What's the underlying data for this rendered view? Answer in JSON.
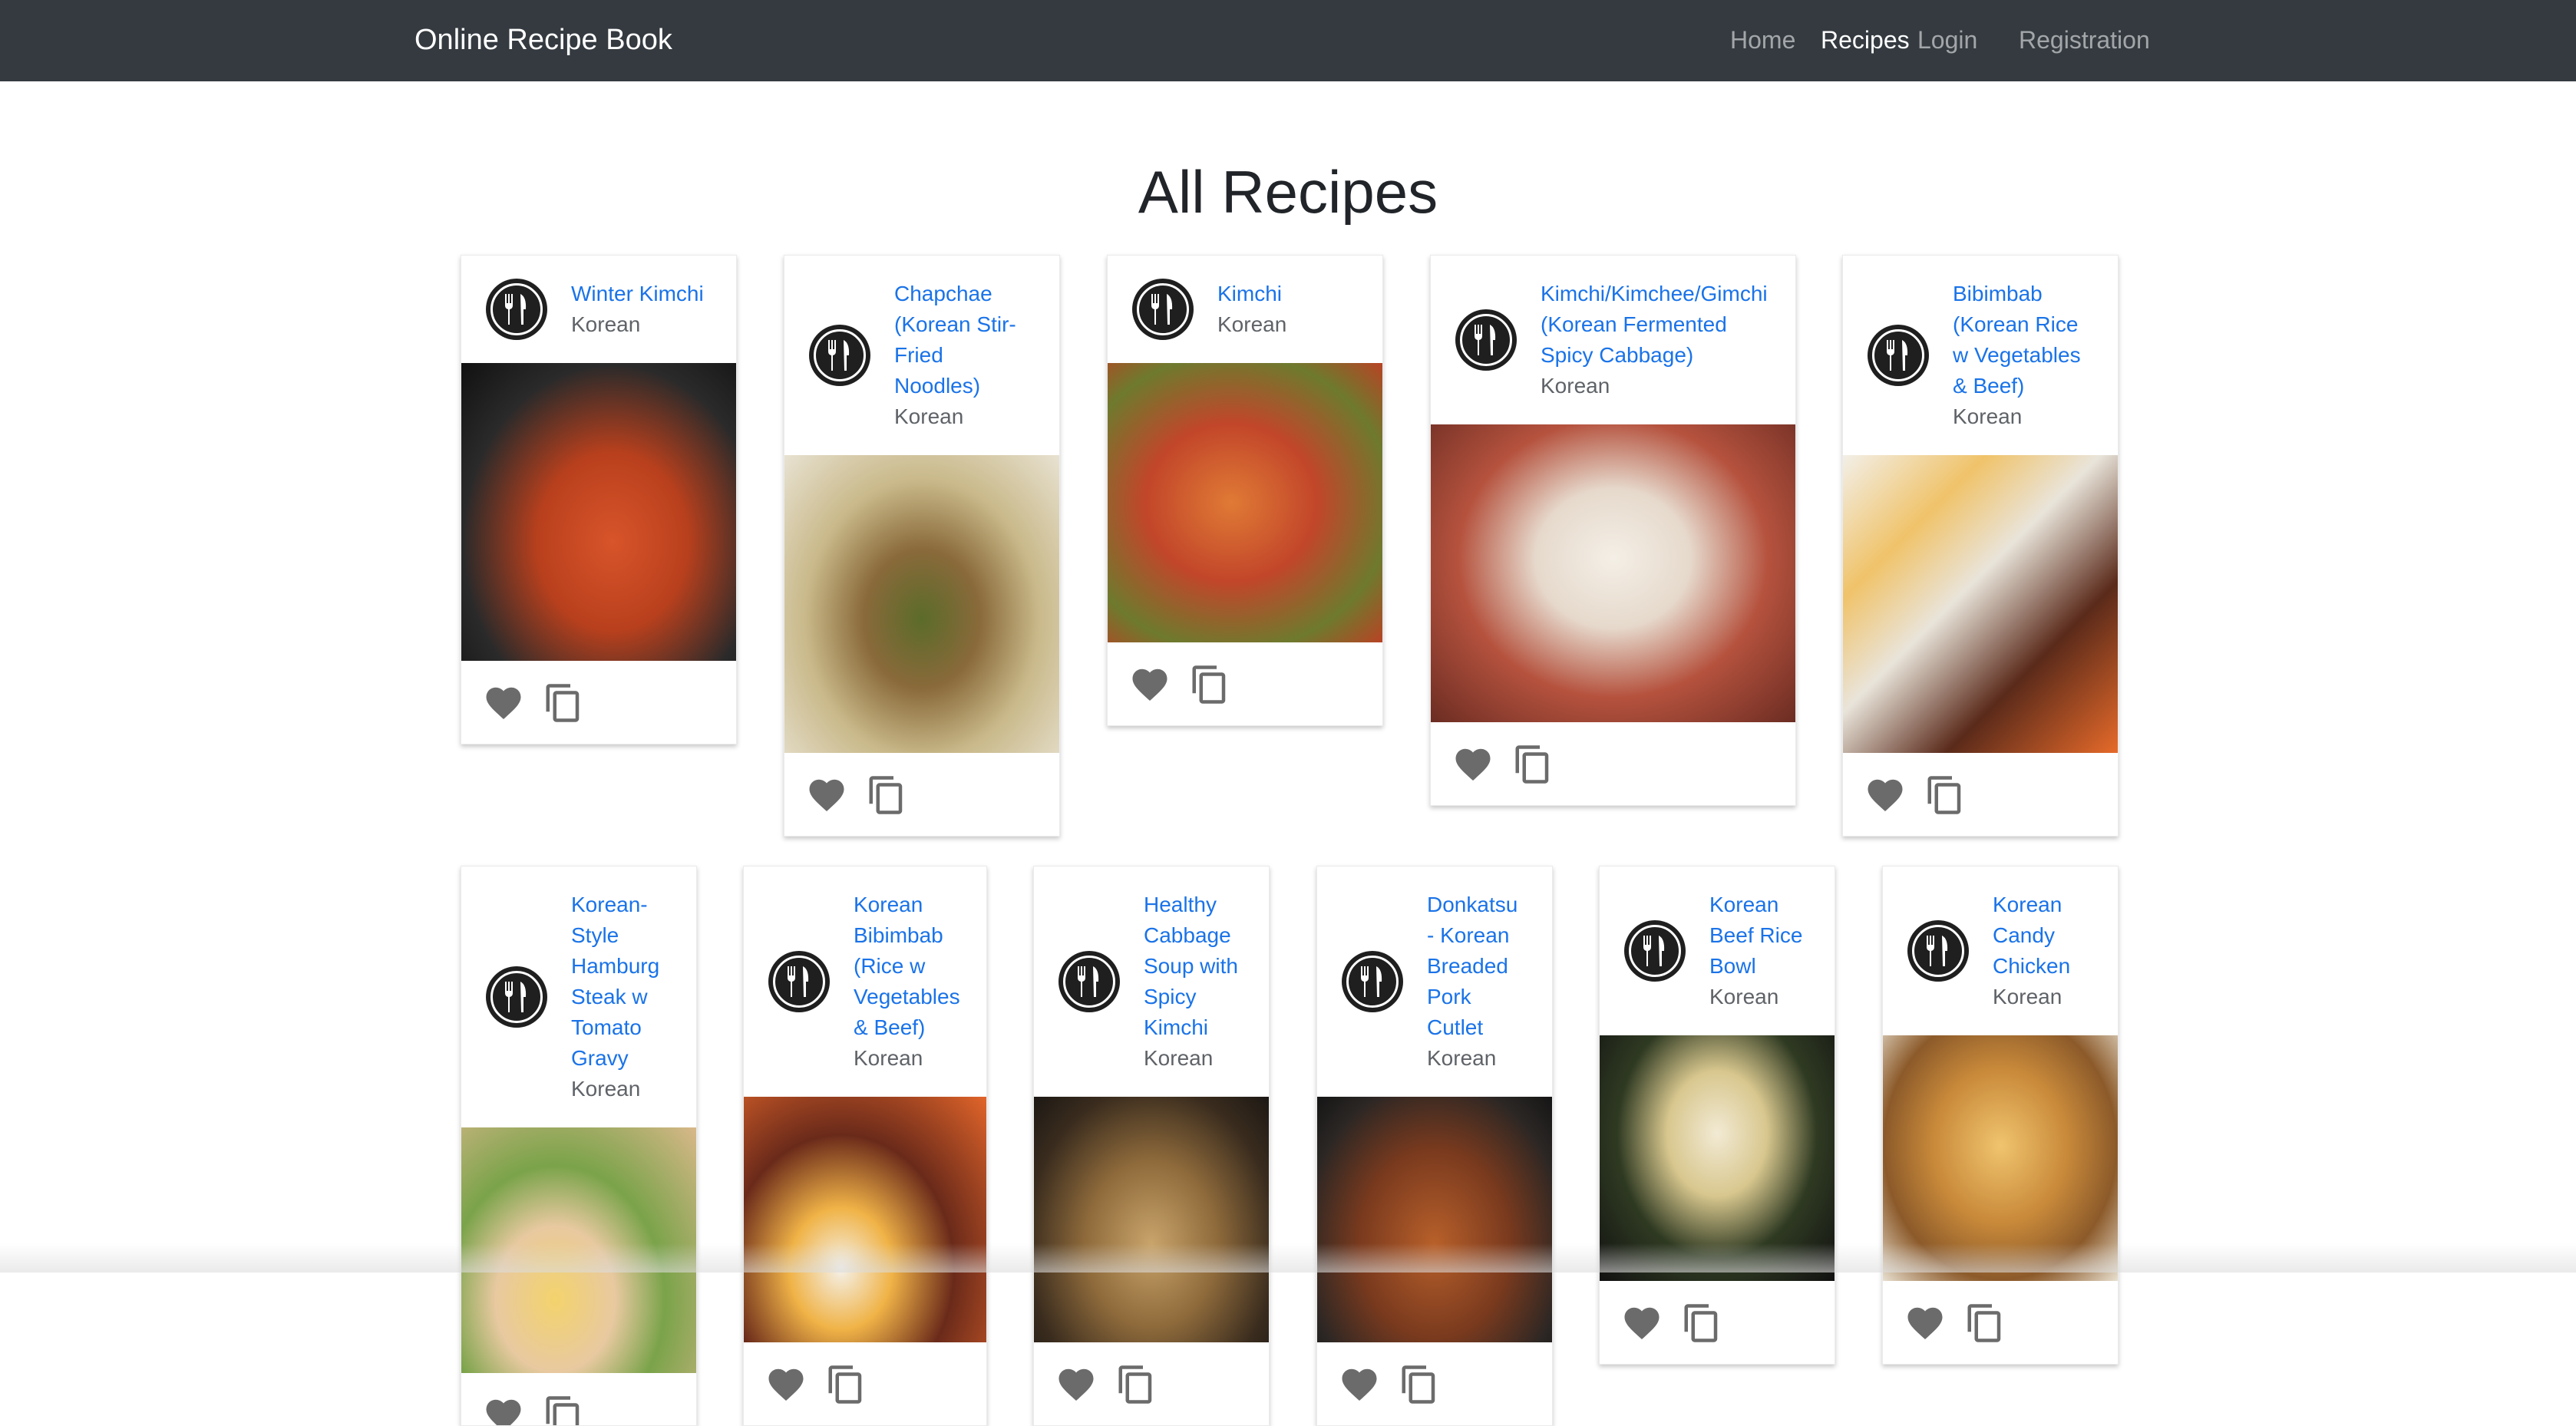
{
  "navbar": {
    "brand": "Online Recipe Book",
    "links": [
      "Home",
      "Recipes",
      "Login",
      "Registration"
    ],
    "active": "Recipes"
  },
  "page_title": "All Recipes",
  "recipes": [
    {
      "title": "Winter Kimchi",
      "cuisine": "Korean"
    },
    {
      "title": "Chapchae (Korean Stir-Fried Noodles)",
      "cuisine": "Korean"
    },
    {
      "title": "Kimchi",
      "cuisine": "Korean"
    },
    {
      "title": "Kimchi/Kimchee/Gimchi (Korean Fermented Spicy Cabbage)",
      "cuisine": "Korean"
    },
    {
      "title": "Bibimbab (Korean Rice w Vegetables & Beef)",
      "cuisine": "Korean"
    },
    {
      "title": "Korean-Style Hamburg Steak w Tomato Gravy",
      "cuisine": "Korean"
    },
    {
      "title": "Korean Bibimbab (Rice w Vegetables & Beef)",
      "cuisine": "Korean"
    },
    {
      "title": "Healthy Cabbage Soup with Spicy Kimchi",
      "cuisine": "Korean"
    },
    {
      "title": "Donkatsu - Korean Breaded Pork Cutlet",
      "cuisine": "Korean"
    },
    {
      "title": "Korean Beef Rice Bowl",
      "cuisine": "Korean"
    },
    {
      "title": "Korean Candy Chicken",
      "cuisine": "Korean"
    }
  ],
  "icons": {
    "avatar": "restaurant-icon",
    "favorite": "heart-icon",
    "copy": "copy-icon"
  },
  "colors": {
    "navbar": "#343a40",
    "link": "#1a73e8",
    "icon": "#6b6b6b"
  }
}
